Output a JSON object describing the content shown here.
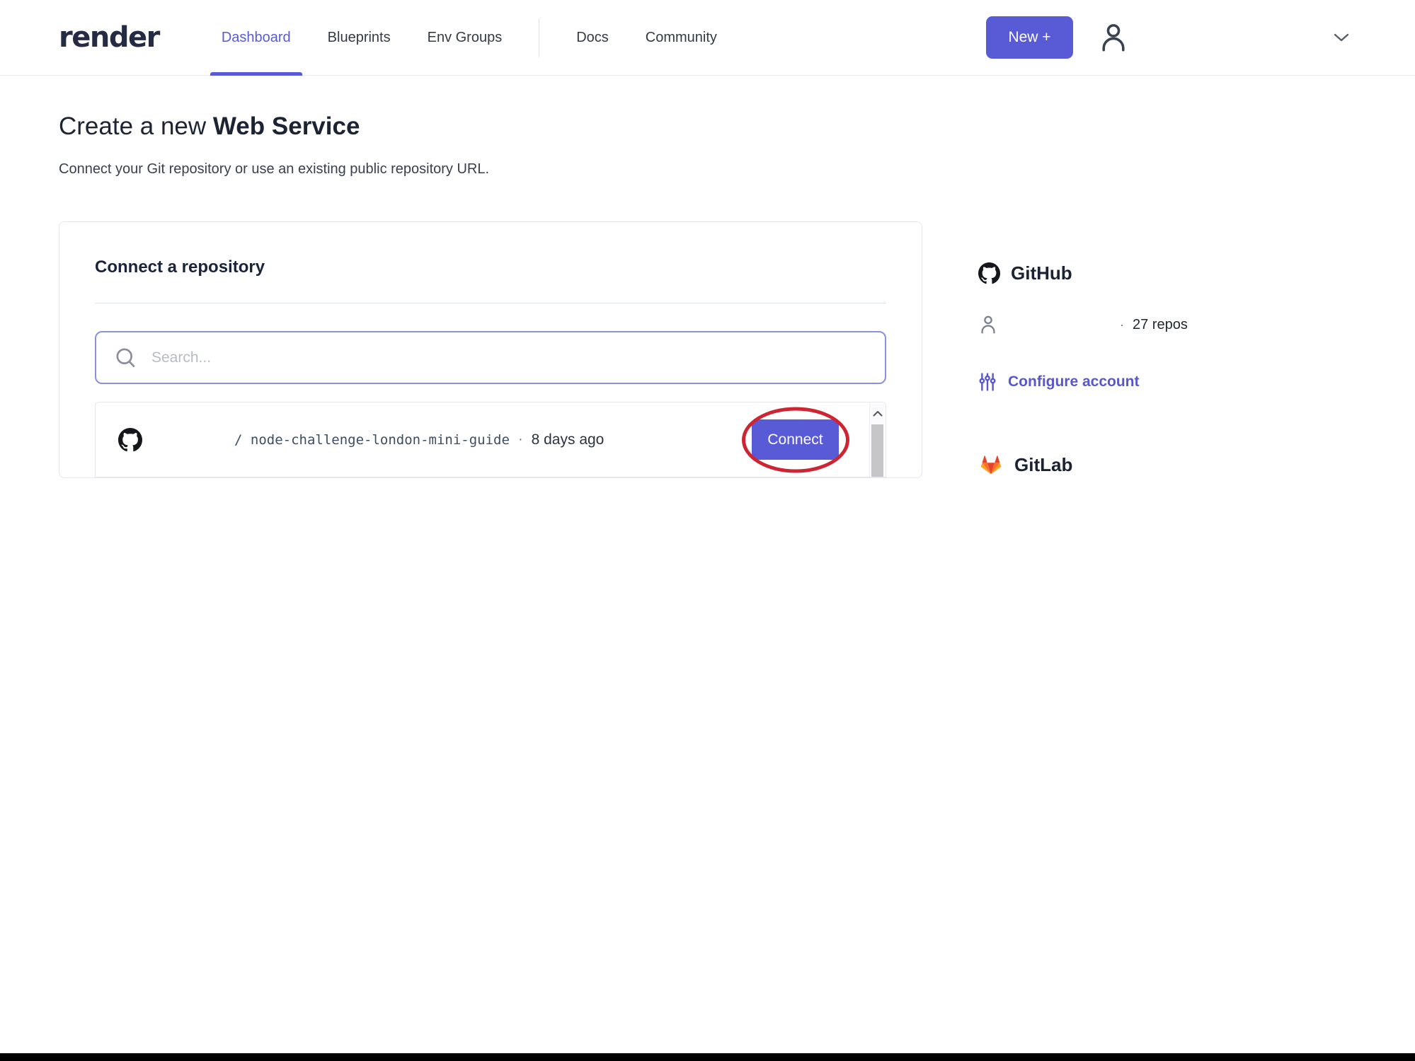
{
  "header": {
    "logo": "render",
    "nav": [
      {
        "label": "Dashboard",
        "active": true
      },
      {
        "label": "Blueprints",
        "active": false
      },
      {
        "label": "Env Groups",
        "active": false
      },
      {
        "label": "Docs",
        "active": false
      },
      {
        "label": "Community",
        "active": false
      }
    ],
    "new_button_label": "New +"
  },
  "page": {
    "title_prefix": "Create a new ",
    "title_emphasis": "Web Service",
    "subtitle": "Connect your Git repository or use an existing public repository URL."
  },
  "card": {
    "heading": "Connect a repository",
    "search_placeholder": "Search...",
    "repo": {
      "owner": "",
      "path": "/ node-challenge-london-mini-guide",
      "separator": "·",
      "updated": "8 days ago",
      "connect_label": "Connect"
    }
  },
  "sidebar": {
    "github": {
      "title": "GitHub",
      "account": "",
      "separator": "·",
      "repo_count": "27 repos",
      "configure_label": "Configure account"
    },
    "gitlab": {
      "title": "GitLab"
    }
  },
  "icons": {
    "search-icon": "magnifier",
    "github-icon": "github-octocat-mark",
    "gitlab-icon": "gitlab-tanuki-fox",
    "user-icon": "person-outline",
    "sliders-icon": "vertical-sliders",
    "chevron-down-icon": "chevron-down",
    "chevron-up-icon": "chevron-up",
    "plus-icon": "plus"
  },
  "colors": {
    "accent": "#585ad6",
    "accent-text": "#5857cb",
    "annotation": "#ce2532",
    "border": "#e4e7ee",
    "footer": "#000000"
  }
}
